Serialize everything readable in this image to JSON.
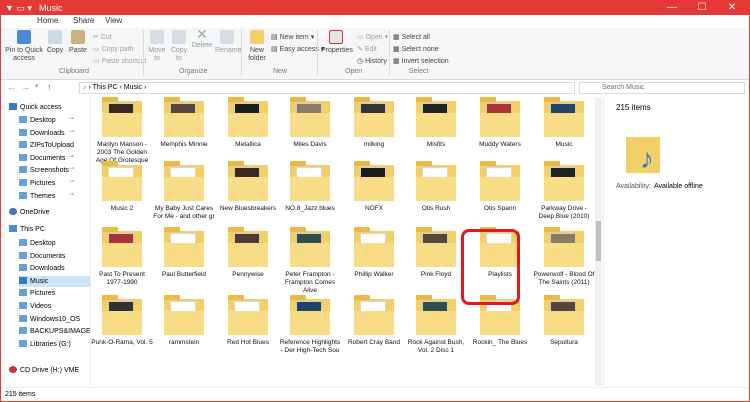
{
  "window": {
    "title": "Music",
    "quick_access_icons": "▼ ▭ ▾",
    "minimize": "—",
    "maximize": "☐",
    "close": "✕"
  },
  "tabs": {
    "file": "F",
    "home": "Home",
    "share": "Share",
    "view": "View"
  },
  "ribbon": {
    "pin": "Pin to Quick access",
    "copy": "Copy",
    "paste": "Paste",
    "cut": "Cut",
    "copy_path": "Copy path",
    "paste_shortcut": "Paste shortcut",
    "move_to": "Move to",
    "copy_to": "Copy to",
    "delete": "Delete",
    "rename": "Rename",
    "new_folder": "New folder",
    "new_item": "New item",
    "easy_access": "Easy access",
    "properties": "Properties",
    "open": "Open",
    "edit": "Edit",
    "history": "History",
    "select_all": "Select all",
    "select_none": "Select none",
    "invert_selection": "Invert selection",
    "groups": {
      "clipboard": "Clipboard",
      "organize": "Organize",
      "new": "New",
      "open": "Open",
      "select": "Select"
    }
  },
  "address": {
    "path_root": "This PC",
    "path_current": "Music",
    "search_placeholder": "Search Music"
  },
  "sidebar": {
    "quick_access": "Quick access",
    "qa_items": [
      "Desktop",
      "Downloads",
      "ZIPsToUpload",
      "Documents",
      "Screenshots",
      "Pictures",
      "Themes"
    ],
    "onedrive": "OneDrive",
    "this_pc": "This PC",
    "pc_items": [
      "Desktop",
      "Documents",
      "Downloads",
      "Music",
      "Pictures",
      "Videos",
      "Windows10_OS",
      "BACKUPS&IMAGES",
      "Libraries (G:)",
      "CD Drive (H:) VME"
    ],
    "cd_drive": "CD Drive (H:) VME"
  },
  "rows": [
    [
      "Marilyn Manson - 2003 The Golden Age Of Grotesque",
      "Memphis Minnie",
      "Metallica",
      "Miles Davis",
      "milking",
      "Misfits",
      "Muddy Waters",
      "Music"
    ],
    [
      "Music 2",
      "My Baby Just Cares For Me - and other gr",
      "New Bluesbreakers",
      "NO.8_Jazz blues",
      "NOFX",
      "Otis Rush",
      "Otis Spann",
      "Parkway Drive - Deep Blue (2010)"
    ],
    [
      "Past To Present 1977-1990",
      "Paul Butterfield",
      "Pennywise",
      "Peter Frampton - Frampton Comes Alive",
      "Phillip Walker",
      "Pink Floyd",
      "Playlists",
      "Powerwolf - Blood Of The Saints (2011)"
    ],
    [
      "Punk-O-Rama, Vol. 5",
      "rammstein",
      "Red Hot Blues",
      "Reference Highlights - Der High-Tech Sou",
      "Robert Cray Band",
      "Rock Against Bush, Vol. 2 Disc 1",
      "Rockin_ The Blues",
      "Sepultura"
    ]
  ],
  "details": {
    "count": "215 items",
    "availability_label": "Availability:",
    "availability_value": "Available offline"
  },
  "status": {
    "count": "215 items"
  },
  "colors": {
    "accent": "#1e5fb4",
    "titlebar": "#e53935",
    "highlight": "#e3181e"
  }
}
